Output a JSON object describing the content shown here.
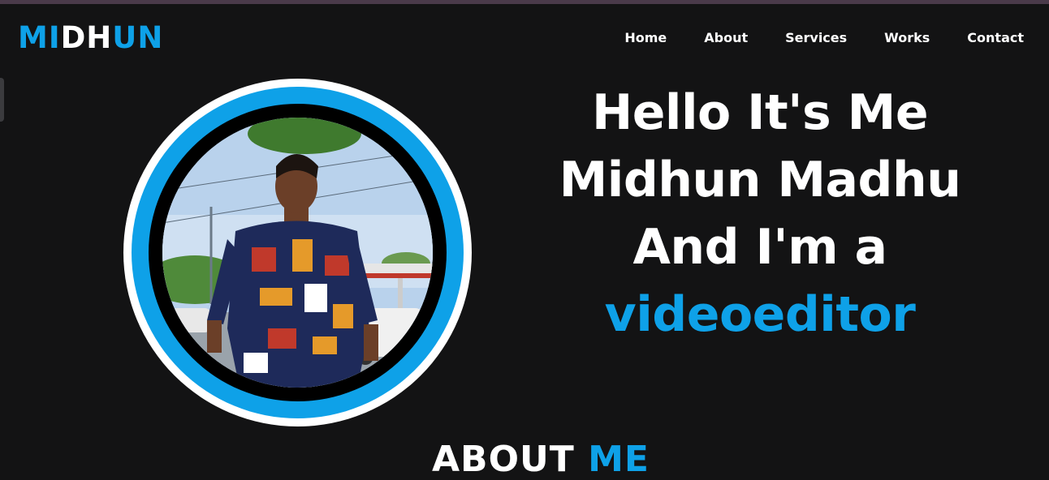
{
  "brand": {
    "logo_part1": "MI",
    "logo_part2": "DH",
    "logo_part3": "UN"
  },
  "nav": {
    "items": [
      {
        "label": "Home"
      },
      {
        "label": "About"
      },
      {
        "label": "Services"
      },
      {
        "label": "Works"
      },
      {
        "label": "Contact"
      }
    ]
  },
  "hero": {
    "line1": "Hello It's Me",
    "line2": "Midhun Madhu",
    "line3": "And I'm a",
    "role": "videoeditor"
  },
  "about": {
    "title_part1": "ABOUT ",
    "title_part2": "ME"
  },
  "colors": {
    "accent": "#0ea1e8",
    "background": "#131314",
    "text": "#ffffff"
  }
}
